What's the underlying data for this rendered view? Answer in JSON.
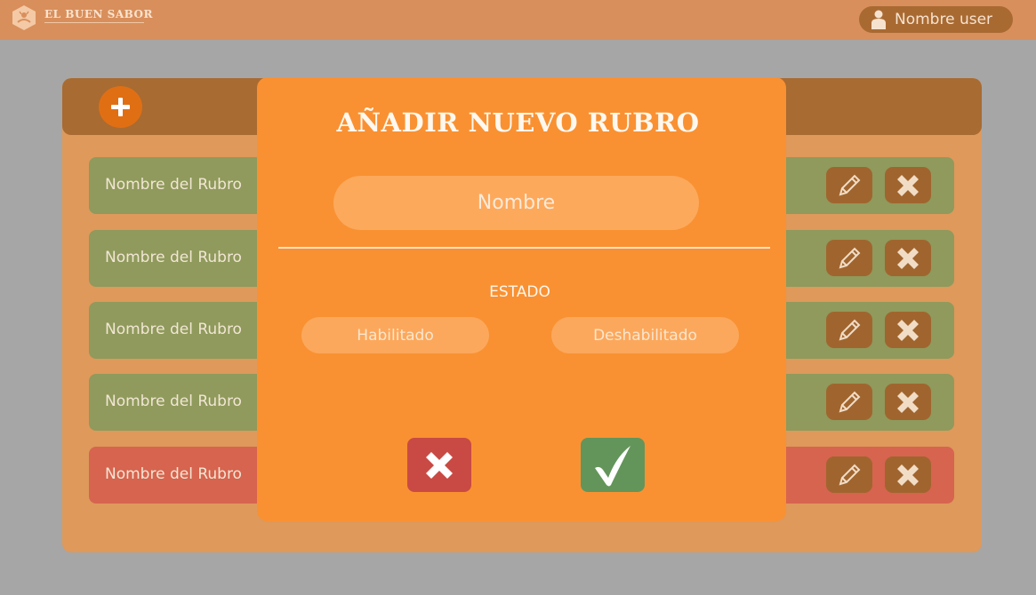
{
  "header": {
    "brand": "EL BUEN SABOR",
    "logo_icon": "chef-hat-logo-icon",
    "user_name": "Nombre user",
    "user_icon": "user-icon"
  },
  "panel": {
    "add_icon": "plus-icon",
    "rows": [
      {
        "label": "Nombre del Rubro",
        "status": "enabled",
        "color": "#8f9a5c"
      },
      {
        "label": "Nombre del Rubro",
        "status": "enabled",
        "color": "#8f9a5c"
      },
      {
        "label": "Nombre del Rubro",
        "status": "enabled",
        "color": "#8f9a5c"
      },
      {
        "label": "Nombre del Rubro",
        "status": "enabled",
        "color": "#8f9a5c"
      },
      {
        "label": "Nombre del Rubro",
        "status": "disabled",
        "color": "#d6644f"
      }
    ],
    "edit_icon": "pencil-icon",
    "delete_icon": "close-icon"
  },
  "modal": {
    "title": "AÑADIR NUEVO RUBRO",
    "name_placeholder": "Nombre",
    "name_value": "",
    "estado_label": "ESTADO",
    "options": [
      "Habilitado",
      "Deshabilitado"
    ],
    "cancel_icon": "close-icon",
    "confirm_icon": "check-icon"
  },
  "colors": {
    "header": "#d98f5b",
    "modal": "#f99132",
    "cancel": "#c94a44",
    "confirm": "#63955a"
  }
}
